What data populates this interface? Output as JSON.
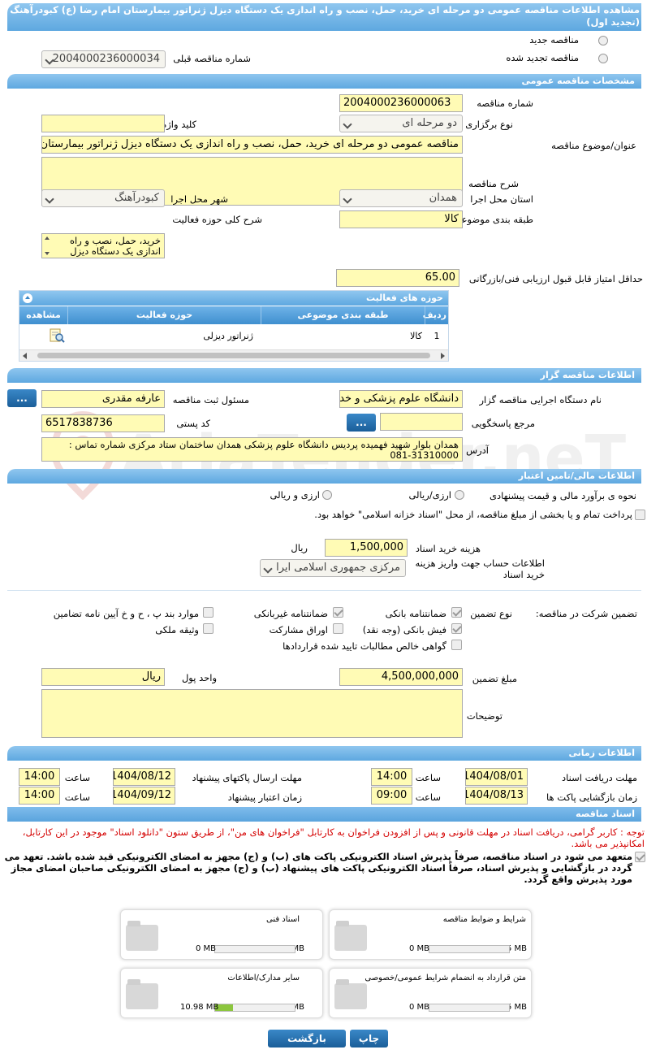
{
  "title": "مشاهده اطلاعات مناقصه عمومی دو مرحله ای خرید، حمل، نصب و راه اندازی یک دستگاه دیزل ژنراتور بیمارستان امام رضا (ع) کبودرآهنگ (تجدید اول)",
  "top": {
    "new_label": "مناقصه جدید",
    "renewed_label": "مناقصه تجدید شده",
    "prev_no_label": "شماره مناقصه قبلی",
    "prev_no_value": "2004000236000034"
  },
  "general": {
    "header": "مشخصات مناقصه عمومی",
    "no_label": "شماره مناقصه",
    "no_value": "2004000236000063",
    "type_label": "نوع برگزاری",
    "type_value": "دو مرحله ای",
    "keyword_label": "کلید واژه",
    "keyword_value": "",
    "subject_label": "عنوان/موضوع مناقصه",
    "subject_value": "مناقصه عمومی دو مرحله ای خرید، حمل، نصب و راه اندازی یک دستگاه دیزل ژنراتور بیمارستان",
    "desc_label": "شرح مناقصه",
    "desc_value": "",
    "province_label": "استان محل اجرا",
    "province_value": "همدان",
    "city_label": "شهر محل اجرا",
    "city_value": "کبودرآهنگ",
    "category_label": "طبقه بندی موضوعی",
    "category_value": "کالا",
    "activity_label": "شرح کلی حوزه فعالیت",
    "activity_value": "خرید، حمل، نصب و راه اندازی یک دستگاه دیزل",
    "minscore_label": "حداقل امتیاز قابل قبول ارزیابی فنی/بازرگانی",
    "minscore_value": "65.00"
  },
  "activity_table": {
    "header": "حوزه های فعالیت",
    "col_row": "ردیف",
    "col_category": "طبقه بندی موضوعی",
    "col_field": "حوزه فعالیت",
    "col_view": "مشاهده",
    "rows": [
      {
        "row": "1",
        "category": "کالا",
        "field": "ژنراتور دیزلی"
      }
    ]
  },
  "organizer": {
    "header": "اطلاعات مناقصه گزار",
    "org_label": "نام دستگاه اجرایی مناقصه گزار",
    "org_value": "دانشگاه علوم پزشکی و خد",
    "resp_label": "مسئول ثبت مناقصه",
    "resp_value": "عارفه مقدری",
    "ref_label": "مرجع پاسخگویی",
    "ref_value": "",
    "postal_label": "کد پستی",
    "postal_value": "6517838736",
    "address_label": "آدرس",
    "address_value": "همدان بلوار شهید فهمیده پردیس دانشگاه علوم پزشکی همدان ساختمان ستاد مرکزی شماره تماس : 31310000-081",
    "btn_dots": "..."
  },
  "finance": {
    "header": "اطلاعات مالی/تامین اعتبار",
    "estimate_label": "نحوه ی برآورد مالی و قیمت پیشنهادی",
    "opt1": "ارزی/ریالی",
    "opt2": "ارزی و ریالی",
    "treasury_text": "پرداخت تمام و یا بخشی از مبلغ مناقصه، از محل \"اسناد خزانه اسلامی\" خواهد بود.",
    "doc_cost_label": "هزینه خرید اسناد",
    "doc_cost_value": "1,500,000",
    "doc_cost_unit": "ریال",
    "account_label": "اطلاعات حساب جهت واریز هزینه خرید اسناد",
    "account_value": "مرکزی جمهوری اسلامی ایرا"
  },
  "guarantee": {
    "label": "تضمین شرکت در مناقصه:",
    "type_label": "نوع تضمین",
    "items": {
      "bank": "ضمانتنامه بانکی",
      "nonbank": "ضمانتنامه غیربانکی",
      "clauses": "موارد بند پ ، ح و خ آیین نامه تضامین",
      "receipt": "فیش بانکی (وجه نقد)",
      "bonds": "اوراق مشارکت",
      "property": "وثیقه ملکی",
      "claims": "گواهی خالص مطالبات تایید شده قراردادها"
    },
    "amount_label": "مبلغ تضمین",
    "amount_value": "4,500,000,000",
    "currency_label": "واحد پول",
    "currency_value": "ریال",
    "notes_label": "توضیحات",
    "notes_value": ""
  },
  "timing": {
    "header": "اطلاعات زمانی",
    "get_docs_label": "مهلت دریافت اسناد",
    "get_docs_date": "1404/08/01",
    "get_docs_time": "14:00",
    "send_label": "مهلت ارسال پاکتهای پیشنهاد",
    "send_date": "1404/08/12",
    "send_time": "14:00",
    "open_label": "زمان بازگشایی پاکت ها",
    "open_date": "1404/08/13",
    "open_time": "09:00",
    "valid_label": "زمان اعتبار پیشنهاد",
    "valid_date": "1404/09/12",
    "valid_time": "14:00",
    "time_label": "ساعت"
  },
  "docs": {
    "header": "اسناد مناقصه",
    "notice": "توجه : کاربر گرامی، دریافت اسناد در مهلت قانونی و پس از افزودن فراخوان به کارتابل \"فراخوان های من\"، از طریق ستون \"دانلود اسناد\" موجود در این کارتابل، امکانپذیر می باشد.",
    "commit": "متعهد می شود در اسناد مناقصه، صرفاً پذیرش اسناد الکترونیکی پاکت های (ب) و (ج) مجهز به امضای الکترونیکی قید شده باشد. تعهد می گردد در بازگشایی و پذیرش اسناد، صرفاً اسناد الکترونیکی پاکت های پیشنهاد (ب) و (ج) مجهز به امضای الکترونیکی صاحبان امضای مجاز مورد پذیرش واقع گردد.",
    "cards": [
      {
        "title": "شرایط و ضوابط مناقصه",
        "used": "0 MB",
        "max": "5 MB",
        "fill": 0
      },
      {
        "title": "اسناد فنی",
        "used": "0 MB",
        "max": "50 MB",
        "fill": 0
      },
      {
        "title": "متن قرارداد به انضمام شرایط عمومی/خصوصی",
        "used": "0 MB",
        "max": "5 MB",
        "fill": 0
      },
      {
        "title": "سایر مدارک/اطلاعات",
        "used": "10.98 MB",
        "max": "50 MB",
        "fill": 0.22
      }
    ]
  },
  "footer": {
    "print": "چاپ",
    "back": "بازگشت"
  },
  "watermark": "AriaTender.neT"
}
